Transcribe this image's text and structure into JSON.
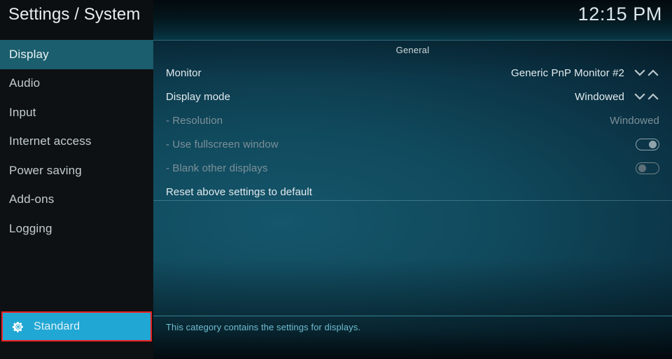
{
  "header": {
    "title": "Settings / System",
    "clock": "12:15 PM"
  },
  "sidebar": {
    "items": [
      {
        "label": "Display",
        "selected": true
      },
      {
        "label": "Audio",
        "selected": false
      },
      {
        "label": "Input",
        "selected": false
      },
      {
        "label": "Internet access",
        "selected": false
      },
      {
        "label": "Power saving",
        "selected": false
      },
      {
        "label": "Add-ons",
        "selected": false
      },
      {
        "label": "Logging",
        "selected": false
      }
    ],
    "profile": {
      "label": "Standard",
      "icon": "gear-icon",
      "highlight_color": "#21a7d4",
      "annotation_color": "#ee2222"
    }
  },
  "content": {
    "group_title": "General",
    "rows": [
      {
        "label": "Monitor",
        "value": "Generic PnP Monitor #2",
        "control": "spinner",
        "disabled": false
      },
      {
        "label": "Display mode",
        "value": "Windowed",
        "control": "spinner",
        "disabled": false
      },
      {
        "label": "- Resolution",
        "value": "Windowed",
        "control": "none",
        "disabled": true
      },
      {
        "label": "- Use fullscreen window",
        "value": "",
        "control": "toggle",
        "toggle_state": "on",
        "disabled": true
      },
      {
        "label": "- Blank other displays",
        "value": "",
        "control": "toggle",
        "toggle_state": "off",
        "disabled": true
      },
      {
        "label": "Reset above settings to default",
        "value": "",
        "control": "none",
        "disabled": false
      }
    ],
    "footer_description": "This category contains the settings for displays."
  }
}
